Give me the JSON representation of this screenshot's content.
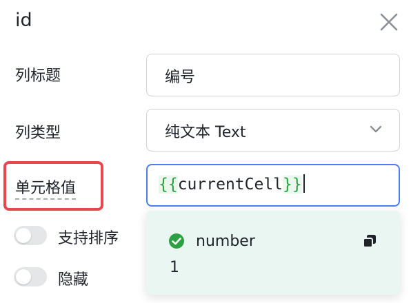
{
  "panel": {
    "title": "id"
  },
  "form": {
    "column_title": {
      "label": "列标题",
      "value": "编号"
    },
    "column_type": {
      "label": "列类型",
      "value": "纯文本 Text"
    },
    "cell_value": {
      "label": "单元格值",
      "open_brace": "{{",
      "expr": "currentCell",
      "close_brace": "}}"
    }
  },
  "toggles": [
    {
      "label": "支持排序",
      "on": false
    },
    {
      "label": "隐藏",
      "on": false
    }
  ],
  "suggestion": {
    "name": "number",
    "value": "1"
  },
  "colors": {
    "accent": "#4a7df0",
    "highlight": "#e8474d",
    "success": "#2ea043",
    "popup_bg": "#eaf6f1"
  }
}
